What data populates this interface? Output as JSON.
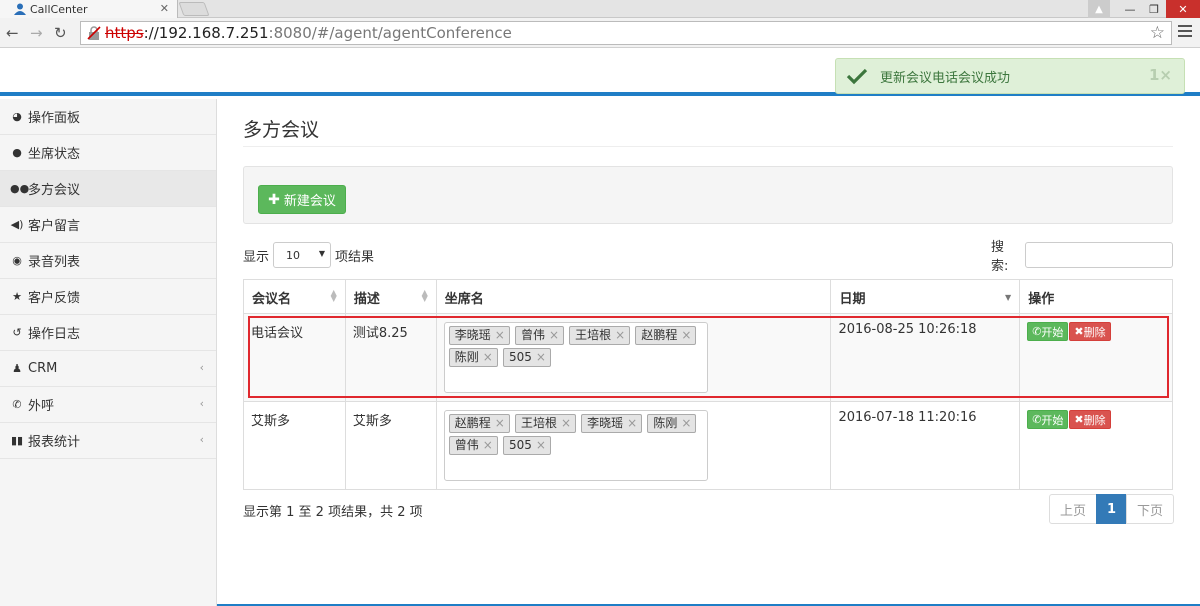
{
  "browser": {
    "tab_title": "CallCenter",
    "url_scheme": "https",
    "url_host": "://192.168.7.251",
    "url_rest": ":8080/#/agent/agentConference"
  },
  "toast": {
    "message": "更新会议电话会议成功",
    "count": "1×"
  },
  "sidebar": {
    "items": [
      {
        "label": "操作面板",
        "icon": "dashboard-icon"
      },
      {
        "label": "坐席状态",
        "icon": "user-icon"
      },
      {
        "label": "多方会议",
        "icon": "users-icon"
      },
      {
        "label": "客户留言",
        "icon": "volume-icon"
      },
      {
        "label": "录音列表",
        "icon": "record-icon"
      },
      {
        "label": "客户反馈",
        "icon": "star-icon"
      },
      {
        "label": "操作日志",
        "icon": "history-icon"
      },
      {
        "label": "CRM",
        "icon": "person-icon"
      },
      {
        "label": "外呼",
        "icon": "phone-icon"
      },
      {
        "label": "报表统计",
        "icon": "bar-chart-icon"
      }
    ]
  },
  "main": {
    "title": "多方会议",
    "new_button": "新建会议",
    "show_label": "显示",
    "page_size": "10",
    "results_label": "项结果",
    "search_label": "搜索:",
    "columns": [
      "会议名",
      "描述",
      "坐席名",
      "日期",
      "操作"
    ],
    "rows": [
      {
        "name": "电话会议",
        "desc": "测试8.25",
        "agents": [
          "李晓瑶",
          "曾伟",
          "王培根",
          "赵鹏程",
          "陈刚",
          "505"
        ],
        "date": "2016-08-25 10:26:18",
        "start": "开始",
        "delete": "删除"
      },
      {
        "name": "艾斯多",
        "desc": "艾斯多",
        "agents": [
          "赵鹏程",
          "王培根",
          "李晓瑶",
          "陈刚",
          "曾伟",
          "505"
        ],
        "date": "2016-07-18 11:20:16",
        "start": "开始",
        "delete": "删除"
      }
    ],
    "info": "显示第 1 至 2 项结果，共 2 项",
    "pager": {
      "prev": "上页",
      "current": "1",
      "next": "下页"
    }
  },
  "colors": {
    "accent": "#1f7ec6",
    "success": "#5cb85c",
    "danger": "#d9534f",
    "highlight_border": "#e0282e"
  }
}
